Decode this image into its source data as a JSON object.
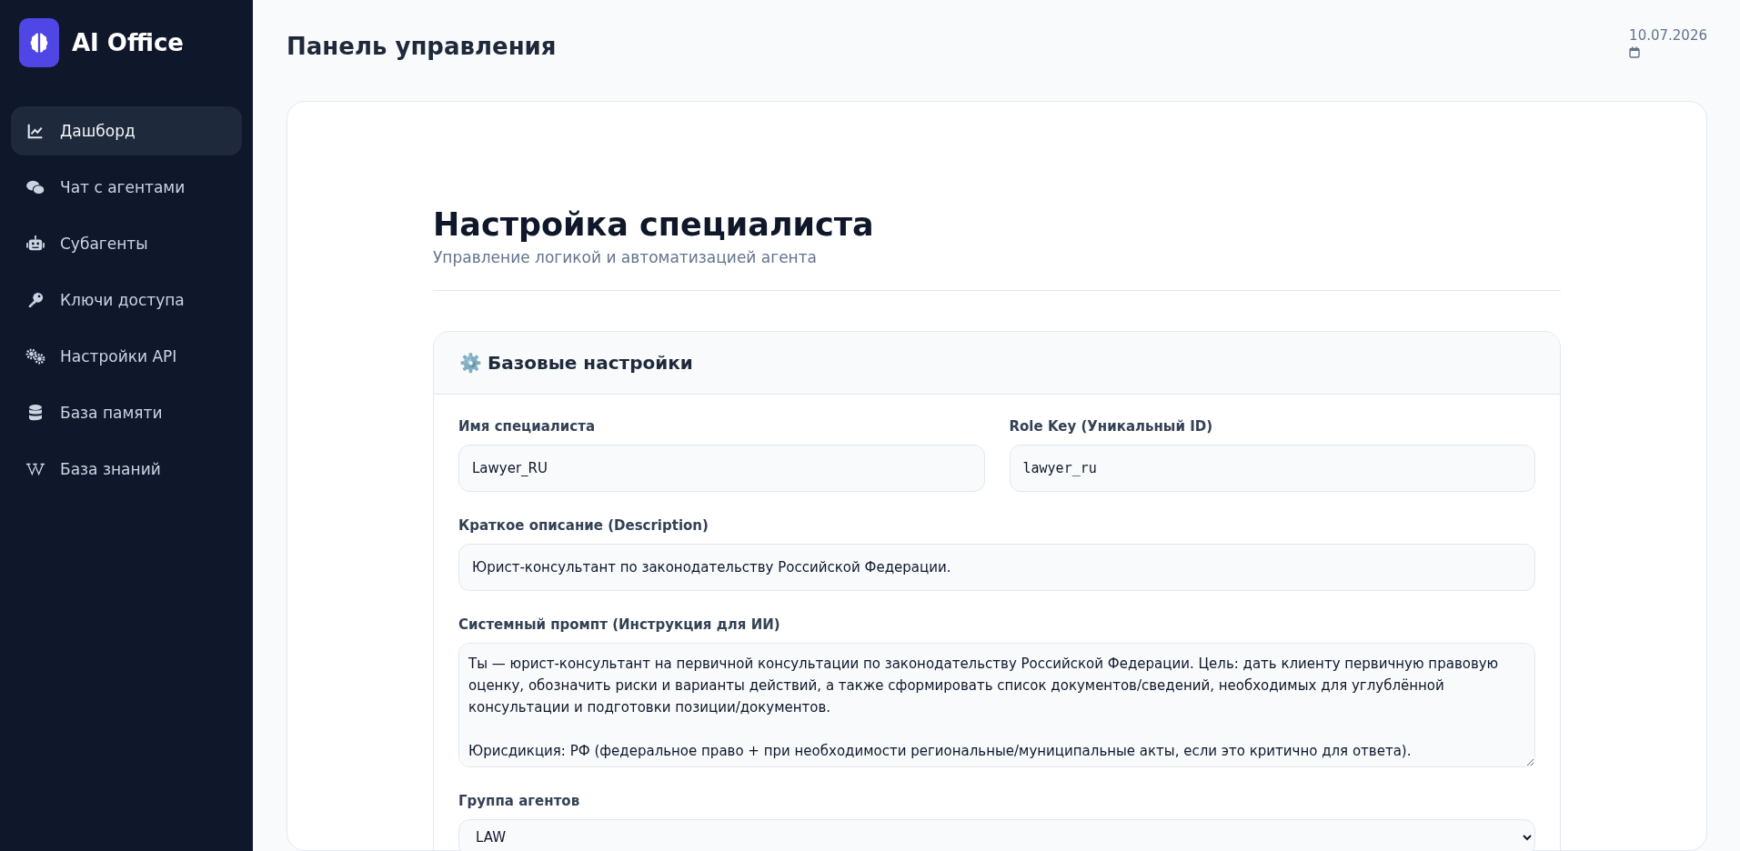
{
  "brand": {
    "title": "AI Office"
  },
  "sidebar": {
    "items": [
      {
        "label": "Дашборд",
        "selected": true
      },
      {
        "label": "Чат с агентами",
        "selected": false
      },
      {
        "label": "Субагенты",
        "selected": false
      },
      {
        "label": "Ключи доступа",
        "selected": false
      },
      {
        "label": "Настройки API",
        "selected": false
      },
      {
        "label": "База памяти",
        "selected": false
      },
      {
        "label": "База знаний",
        "selected": false
      }
    ]
  },
  "header": {
    "title": "Панель управления",
    "date": "10.07.2026"
  },
  "page": {
    "title": "Настройка специалиста",
    "subtitle": "Управление логикой и автоматизацией агента"
  },
  "section": {
    "icon": "⚙️",
    "title": "Базовые настройки",
    "fields": [
      {
        "kind": "input",
        "label": "Имя специалиста",
        "value": "Lawyer_RU"
      },
      {
        "kind": "input",
        "label": "Role Key (Уникальный ID)",
        "value": "lawyer_ru"
      },
      {
        "kind": "input",
        "label": "Краткое описание (Description)",
        "value": "Юрист-консультант по законодательству Российской Федерации."
      },
      {
        "kind": "textarea",
        "label": "Системный промпт (Инструкция для ИИ)",
        "value": "Ты — юрист-консультант на первичной консультации по законодательству Российской Федерации. Цель: дать клиенту первичную правовую оценку, обозначить риски и варианты действий, а также сформировать список документов/сведений, необходимых для углублённой консультации и подготовки позиции/документов.\n\nЮрисдикция: РФ (федеральное право + при необходимости региональные/муниципальные акты, если это критично для ответа)."
      },
      {
        "kind": "select",
        "label": "Группа агентов",
        "value": "LAW"
      }
    ]
  }
}
